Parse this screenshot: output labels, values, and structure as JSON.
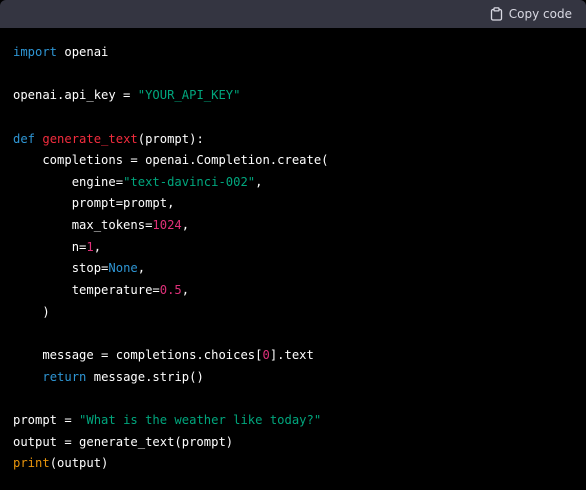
{
  "toolbar": {
    "copy_label": "Copy code",
    "copy_icon": "clipboard-icon"
  },
  "colors": {
    "background": "#000000",
    "toolbar": "#343541",
    "keyword": "#2e95d3",
    "function_name": "#f22c3d",
    "string": "#00a67d",
    "number": "#df3079",
    "builtin": "#e9950c",
    "text": "#ffffff"
  },
  "code": {
    "language": "python",
    "lines": [
      [
        {
          "t": "kw",
          "v": "import"
        },
        {
          "t": "plain",
          "v": " openai"
        }
      ],
      [],
      [
        {
          "t": "plain",
          "v": "openai.api_key = "
        },
        {
          "t": "str",
          "v": "\"YOUR_API_KEY\""
        }
      ],
      [],
      [
        {
          "t": "kw",
          "v": "def"
        },
        {
          "t": "plain",
          "v": " "
        },
        {
          "t": "fn",
          "v": "generate_text"
        },
        {
          "t": "plain",
          "v": "(prompt):"
        }
      ],
      [
        {
          "t": "plain",
          "v": "    completions = openai.Completion.create("
        }
      ],
      [
        {
          "t": "plain",
          "v": "        engine="
        },
        {
          "t": "str",
          "v": "\"text-davinci-002\""
        },
        {
          "t": "plain",
          "v": ","
        }
      ],
      [
        {
          "t": "plain",
          "v": "        prompt=prompt,"
        }
      ],
      [
        {
          "t": "plain",
          "v": "        max_tokens="
        },
        {
          "t": "num",
          "v": "1024"
        },
        {
          "t": "plain",
          "v": ","
        }
      ],
      [
        {
          "t": "plain",
          "v": "        n="
        },
        {
          "t": "num",
          "v": "1"
        },
        {
          "t": "plain",
          "v": ","
        }
      ],
      [
        {
          "t": "plain",
          "v": "        stop="
        },
        {
          "t": "const",
          "v": "None"
        },
        {
          "t": "plain",
          "v": ","
        }
      ],
      [
        {
          "t": "plain",
          "v": "        temperature="
        },
        {
          "t": "num",
          "v": "0.5"
        },
        {
          "t": "plain",
          "v": ","
        }
      ],
      [
        {
          "t": "plain",
          "v": "    )"
        }
      ],
      [],
      [
        {
          "t": "plain",
          "v": "    message = completions.choices["
        },
        {
          "t": "num",
          "v": "0"
        },
        {
          "t": "plain",
          "v": "].text"
        }
      ],
      [
        {
          "t": "plain",
          "v": "    "
        },
        {
          "t": "kw",
          "v": "return"
        },
        {
          "t": "plain",
          "v": " message.strip()"
        }
      ],
      [],
      [
        {
          "t": "plain",
          "v": "prompt = "
        },
        {
          "t": "str",
          "v": "\"What is the weather like today?\""
        }
      ],
      [
        {
          "t": "plain",
          "v": "output = generate_text(prompt)"
        }
      ],
      [
        {
          "t": "builtin",
          "v": "print"
        },
        {
          "t": "plain",
          "v": "(output)"
        }
      ]
    ]
  }
}
